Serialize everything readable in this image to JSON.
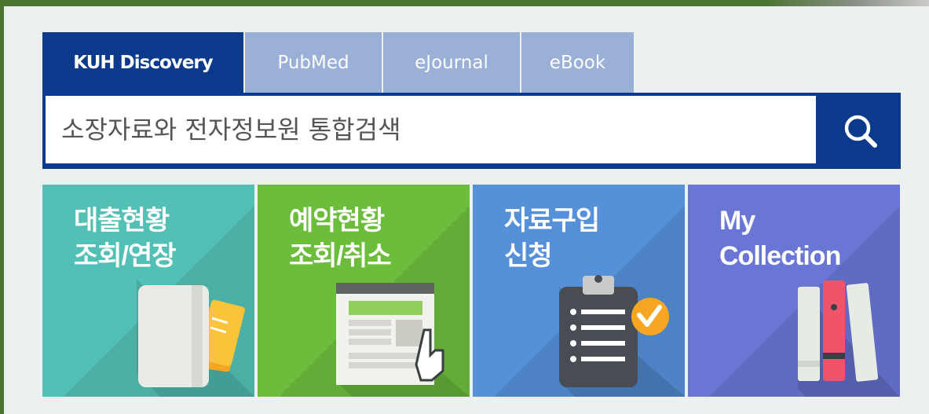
{
  "tabs": [
    {
      "label": "KUH Discovery",
      "active": true,
      "width": 258
    },
    {
      "label": "PubMed",
      "active": false,
      "width": 176
    },
    {
      "label": "eJournal",
      "active": false,
      "width": 176
    },
    {
      "label": "eBook",
      "active": false,
      "width": 143
    }
  ],
  "search": {
    "placeholder": "소장자료와 전자정보원 통합검색",
    "button_icon": "search-icon"
  },
  "tiles": [
    {
      "label": "대출현황\n조회/연장",
      "color": "#52c0b5",
      "icon": "book-notes-icon"
    },
    {
      "label": "예약현황\n조회/취소",
      "color": "#6cbd3c",
      "icon": "browser-click-icon"
    },
    {
      "label": "자료구입\n신청",
      "color": "#5590d9",
      "icon": "clipboard-check-icon"
    },
    {
      "label": "My\nCollection",
      "color": "#6a76d6",
      "icon": "books-icon"
    }
  ],
  "colors": {
    "primary": "#0b3a8d",
    "tab_inactive": "#9bb0d7",
    "frame": "#4a7530",
    "panel": "#edf0f1"
  }
}
